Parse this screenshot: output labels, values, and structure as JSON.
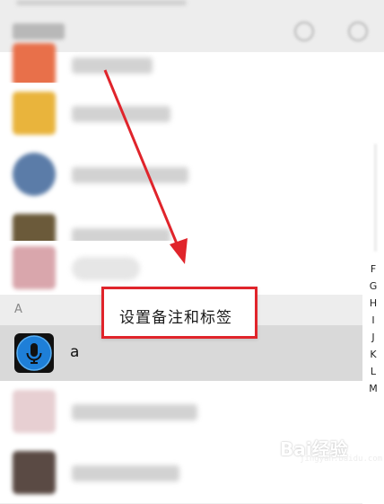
{
  "section": {
    "letter": "A"
  },
  "contact": {
    "name": "a"
  },
  "index_letters": [
    "F",
    "G",
    "H",
    "I",
    "J",
    "K",
    "L",
    "M"
  ],
  "context_menu": {
    "item": "设置备注和标签"
  },
  "colors": {
    "accent_red": "#e0242b",
    "selected_row": "#d9d9d9",
    "section_bg": "#ededed"
  },
  "watermark": {
    "text": "Bai经验",
    "subtext": "jingyan.baidu.com"
  }
}
